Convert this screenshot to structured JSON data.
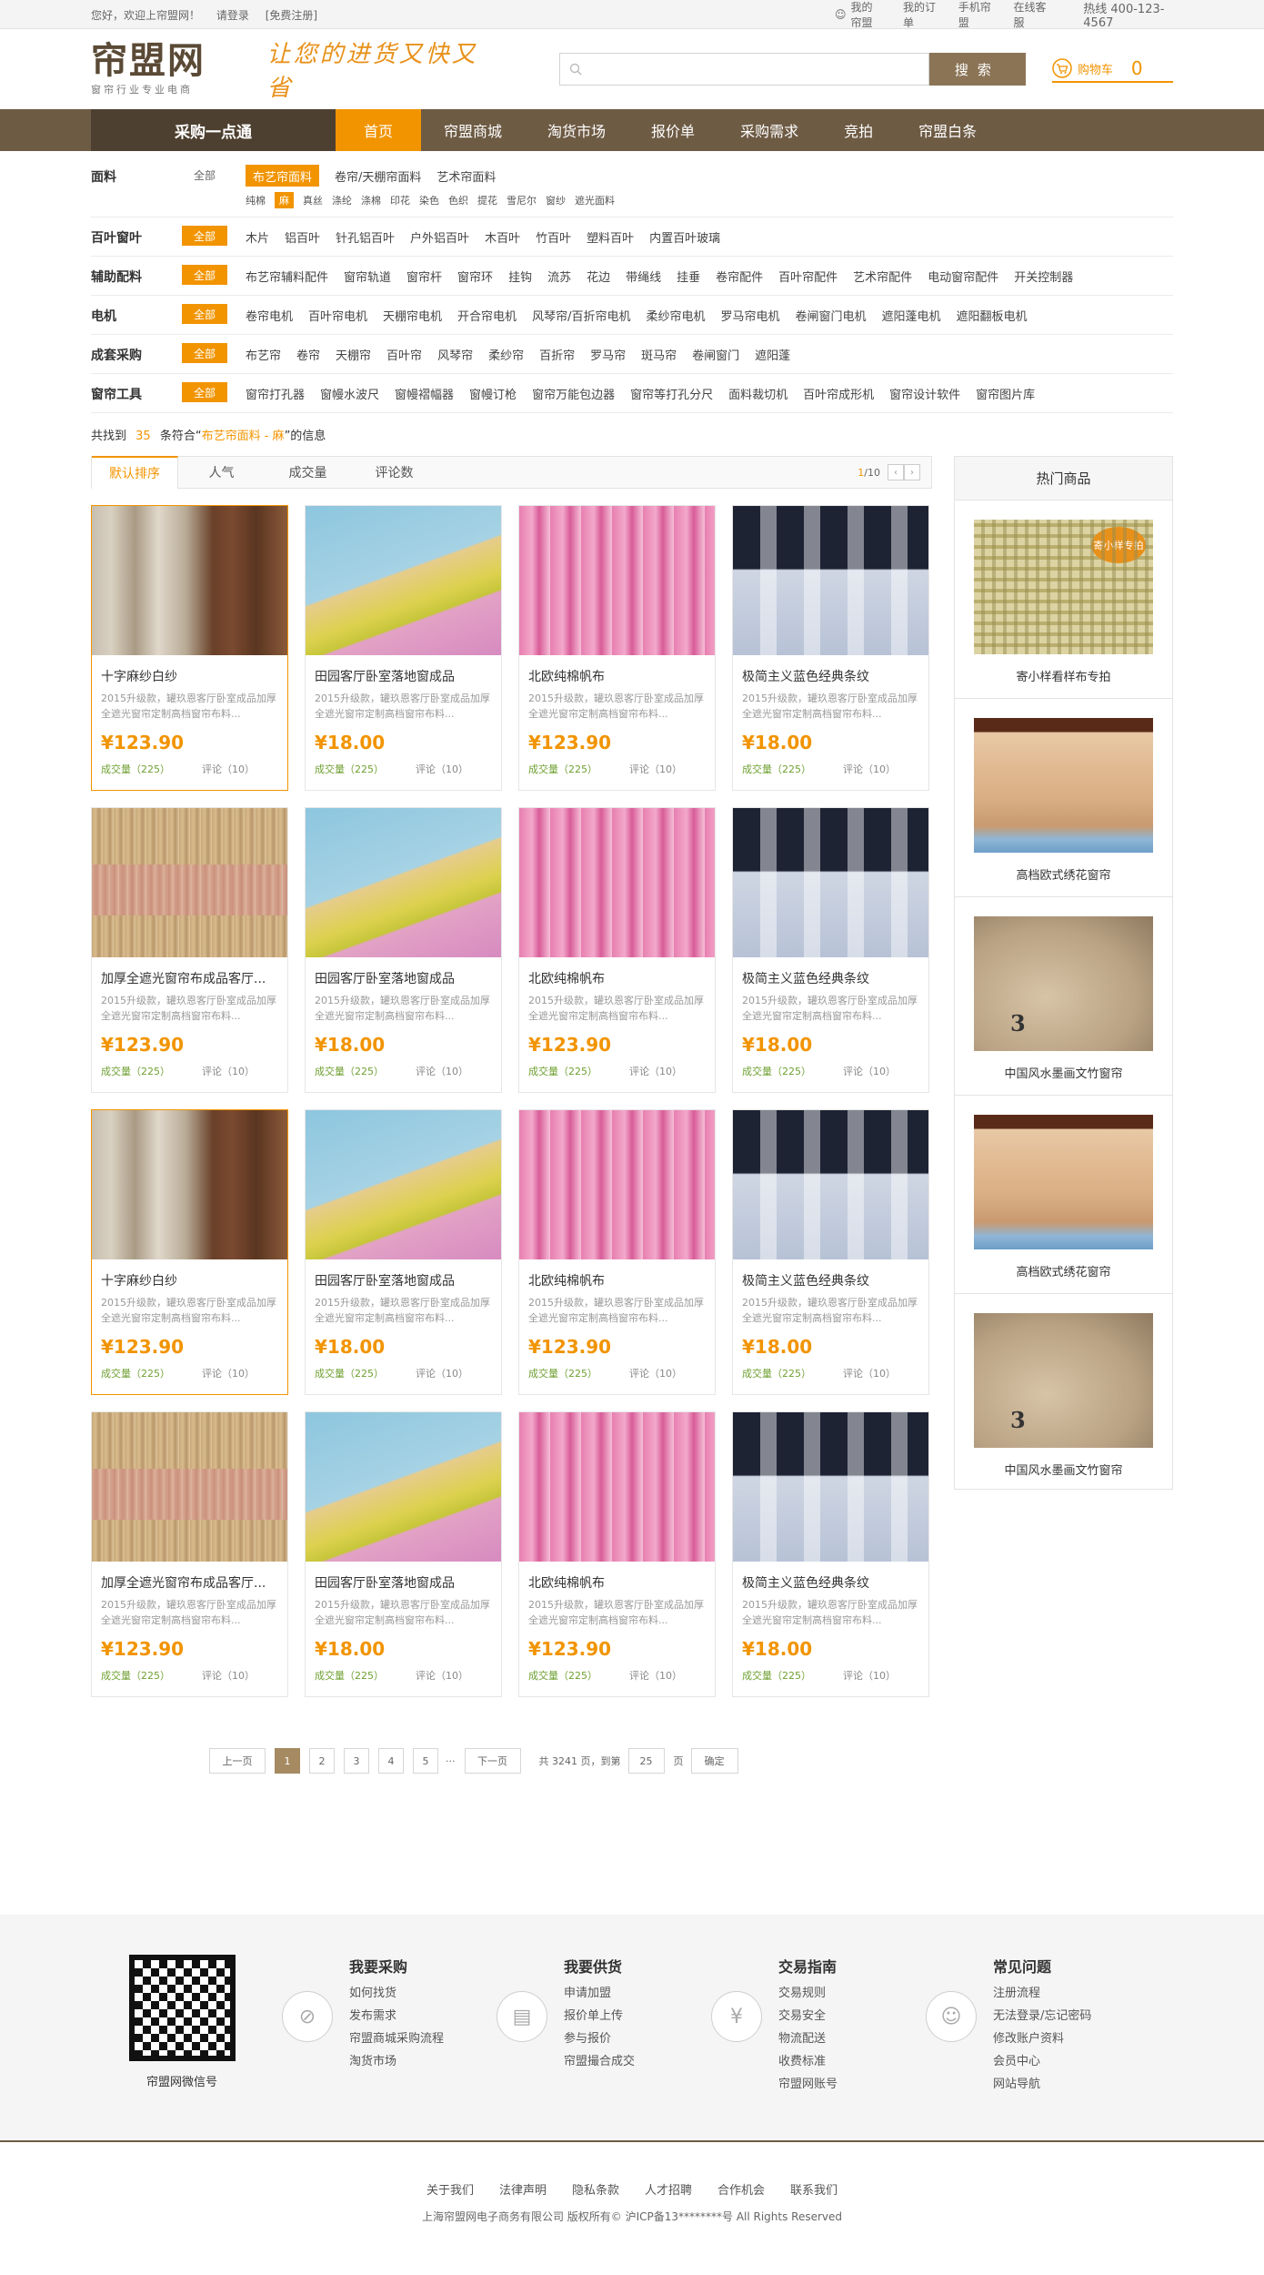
{
  "topbar": {
    "welcome": "您好，欢迎上帘盟网！",
    "login": "请登录",
    "register": "[免费注册]",
    "links": [
      "我的帘盟",
      "我的订单",
      "手机帘盟",
      "在线客服"
    ],
    "hotline": "热线 400-123-4567"
  },
  "header": {
    "logo_title": "帘盟网",
    "logo_sub": "窗帘行业专业电商",
    "slogan": "让您的进货又快又省",
    "search_button": "搜索",
    "cart_label": "购物车",
    "cart_count": "0"
  },
  "nav": {
    "category": "采购一点通",
    "items": [
      "首页",
      "帘盟商城",
      "淘货市场",
      "报价单",
      "采购需求",
      "竞拍",
      "帘盟白条"
    ],
    "active_index": 0
  },
  "filters": [
    {
      "label": "面料",
      "all": "全部",
      "all_on": false,
      "options": [
        "布艺帘面料",
        "卷帘/天棚帘面料",
        "艺术帘面料"
      ],
      "selected": 0,
      "sub": [
        "纯棉",
        "麻",
        "真丝",
        "涤纶",
        "涤棉",
        "印花",
        "染色",
        "色织",
        "提花",
        "雪尼尔",
        "窗纱",
        "遮光面料"
      ],
      "sub_selected": 1
    },
    {
      "label": "百叶窗叶",
      "all": "全部",
      "all_on": true,
      "options": [
        "木片",
        "铝百叶",
        "针孔铝百叶",
        "户外铝百叶",
        "木百叶",
        "竹百叶",
        "塑料百叶",
        "内置百叶玻璃"
      ]
    },
    {
      "label": "辅助配料",
      "all": "全部",
      "all_on": true,
      "options": [
        "布艺帘辅料配件",
        "窗帘轨道",
        "窗帘杆",
        "窗帘环",
        "挂钩",
        "流苏",
        "花边",
        "带绳线",
        "挂垂",
        "卷帘配件",
        "百叶帘配件",
        "艺术帘配件",
        "电动窗帘配件",
        "开关控制器"
      ]
    },
    {
      "label": "电机",
      "all": "全部",
      "all_on": true,
      "options": [
        "卷帘电机",
        "百叶帘电机",
        "天棚帘电机",
        "开合帘电机",
        "风琴帘/百折帘电机",
        "柔纱帘电机",
        "罗马帘电机",
        "卷闸窗门电机",
        "遮阳蓬电机",
        "遮阳翻板电机"
      ]
    },
    {
      "label": "成套采购",
      "all": "全部",
      "all_on": true,
      "options": [
        "布艺帘",
        "卷帘",
        "天棚帘",
        "百叶帘",
        "风琴帘",
        "柔纱帘",
        "百折帘",
        "罗马帘",
        "斑马帘",
        "卷闸窗门",
        "遮阳蓬"
      ]
    },
    {
      "label": "窗帘工具",
      "all": "全部",
      "all_on": true,
      "options": [
        "窗帘打孔器",
        "窗幔水波尺",
        "窗幔褶幅器",
        "窗幔订枪",
        "窗帘万能包边器",
        "窗帘等打孔分尺",
        "面料裁切机",
        "百叶帘成形机",
        "窗帘设计软件",
        "窗帘图片库"
      ]
    }
  ],
  "result": {
    "prefix": "共找到",
    "count": "35",
    "mid": "条符合“",
    "keyword": "布艺帘面料 - 麻",
    "suffix": "”的信息"
  },
  "sort": {
    "tabs": [
      "默认排序",
      "人气",
      "成交量",
      "评论数"
    ],
    "active_index": 0,
    "page_current": "1",
    "page_total": "/10",
    "prev_arrow": "‹",
    "next_arrow": "›"
  },
  "products": [
    {
      "name": "十字麻纱白纱",
      "desc": "2015升级款，罐玖恩客厅卧室成品加厚全遮光窗帘定制高档窗帘布料...",
      "price": "¥123.90",
      "deal": "成交量（225）",
      "reviews": "评论（10）",
      "img": "linen",
      "highlight": true
    },
    {
      "name": "田园客厅卧室落地窗成品",
      "desc": "2015升级款，罐玖恩客厅卧室成品加厚全遮光窗帘定制高档窗帘布料...",
      "price": "¥18.00",
      "deal": "成交量（225）",
      "reviews": "评论（10）",
      "img": "blue",
      "highlight": false
    },
    {
      "name": "北欧纯棉帆布",
      "desc": "2015升级款，罐玖恩客厅卧室成品加厚全遮光窗帘定制高档窗帘布料...",
      "price": "¥123.90",
      "deal": "成交量（225）",
      "reviews": "评论（10）",
      "img": "pink",
      "highlight": false
    },
    {
      "name": "极简主义蓝色经典条纹",
      "desc": "2015升级款，罐玖恩客厅卧室成品加厚全遮光窗帘定制高档窗帘布料...",
      "price": "¥18.00",
      "deal": "成交量（225）",
      "reviews": "评论（10）",
      "img": "navy",
      "highlight": false
    },
    {
      "name": "加厚全遮光窗帘布成品客厅...",
      "desc": "2015升级款，罐玖恩客厅卧室成品加厚全遮光窗帘定制高档窗帘布料...",
      "price": "¥123.90",
      "deal": "成交量（225）",
      "reviews": "评论（10）",
      "img": "stripe",
      "highlight": false
    },
    {
      "name": "田园客厅卧室落地窗成品",
      "desc": "2015升级款，罐玖恩客厅卧室成品加厚全遮光窗帘定制高档窗帘布料...",
      "price": "¥18.00",
      "deal": "成交量（225）",
      "reviews": "评论（10）",
      "img": "blue",
      "highlight": false
    },
    {
      "name": "北欧纯棉帆布",
      "desc": "2015升级款，罐玖恩客厅卧室成品加厚全遮光窗帘定制高档窗帘布料...",
      "price": "¥123.90",
      "deal": "成交量（225）",
      "reviews": "评论（10）",
      "img": "pink",
      "highlight": false
    },
    {
      "name": "极简主义蓝色经典条纹",
      "desc": "2015升级款，罐玖恩客厅卧室成品加厚全遮光窗帘定制高档窗帘布料...",
      "price": "¥18.00",
      "deal": "成交量（225）",
      "reviews": "评论（10）",
      "img": "navy",
      "highlight": false
    },
    {
      "name": "十字麻纱白纱",
      "desc": "2015升级款，罐玖恩客厅卧室成品加厚全遮光窗帘定制高档窗帘布料...",
      "price": "¥123.90",
      "deal": "成交量（225）",
      "reviews": "评论（10）",
      "img": "linen",
      "highlight": true
    },
    {
      "name": "田园客厅卧室落地窗成品",
      "desc": "2015升级款，罐玖恩客厅卧室成品加厚全遮光窗帘定制高档窗帘布料...",
      "price": "¥18.00",
      "deal": "成交量（225）",
      "reviews": "评论（10）",
      "img": "blue",
      "highlight": false
    },
    {
      "name": "北欧纯棉帆布",
      "desc": "2015升级款，罐玖恩客厅卧室成品加厚全遮光窗帘定制高档窗帘布料...",
      "price": "¥123.90",
      "deal": "成交量（225）",
      "reviews": "评论（10）",
      "img": "pink",
      "highlight": false
    },
    {
      "name": "极简主义蓝色经典条纹",
      "desc": "2015升级款，罐玖恩客厅卧室成品加厚全遮光窗帘定制高档窗帘布料...",
      "price": "¥18.00",
      "deal": "成交量（225）",
      "reviews": "评论（10）",
      "img": "navy",
      "highlight": false
    },
    {
      "name": "加厚全遮光窗帘布成品客厅...",
      "desc": "2015升级款，罐玖恩客厅卧室成品加厚全遮光窗帘定制高档窗帘布料...",
      "price": "¥123.90",
      "deal": "成交量（225）",
      "reviews": "评论（10）",
      "img": "stripe",
      "highlight": false
    },
    {
      "name": "田园客厅卧室落地窗成品",
      "desc": "2015升级款，罐玖恩客厅卧室成品加厚全遮光窗帘定制高档窗帘布料...",
      "price": "¥18.00",
      "deal": "成交量（225）",
      "reviews": "评论（10）",
      "img": "blue",
      "highlight": false
    },
    {
      "name": "北欧纯棉帆布",
      "desc": "2015升级款，罐玖恩客厅卧室成品加厚全遮光窗帘定制高档窗帘布料...",
      "price": "¥123.90",
      "deal": "成交量（225）",
      "reviews": "评论（10）",
      "img": "pink",
      "highlight": false
    },
    {
      "name": "极简主义蓝色经典条纹",
      "desc": "2015升级款，罐玖恩客厅卧室成品加厚全遮光窗帘定制高档窗帘布料...",
      "price": "¥18.00",
      "deal": "成交量（225）",
      "reviews": "评论（10）",
      "img": "navy",
      "highlight": false
    }
  ],
  "side": {
    "title": "热门商品",
    "items": [
      {
        "name": "寄小样看样布专拍",
        "img": "plaid",
        "tag": "寄小样专拍"
      },
      {
        "name": "高档欧式绣花窗帘",
        "img": "roman"
      },
      {
        "name": "中国风水墨画文竹窗帘",
        "img": "roll",
        "tag": "3"
      },
      {
        "name": "高档欧式绣花窗帘",
        "img": "roman"
      },
      {
        "name": "中国风水墨画文竹窗帘",
        "img": "roll",
        "tag": "3"
      }
    ]
  },
  "pager": {
    "prev": "上一页",
    "pages": [
      "1",
      "2",
      "3",
      "4",
      "5"
    ],
    "current": "1",
    "ellipsis": "···",
    "next": "下一页",
    "total_text": "共 3241 页，到第",
    "goto_value": "25",
    "page_unit": "页",
    "confirm": "确定"
  },
  "footer": {
    "qr_caption": "帘盟网微信号",
    "columns": [
      {
        "title": "我要采购",
        "icon": "compass-icon",
        "links": [
          "如何找货",
          "发布需求",
          "帘盟商城采购流程",
          "淘货市场"
        ]
      },
      {
        "title": "我要供货",
        "icon": "printer-icon",
        "links": [
          "申请加盟",
          "报价单上传",
          "参与报价",
          "帘盟撮合成交"
        ]
      },
      {
        "title": "交易指南",
        "icon": "yen-icon",
        "links": [
          "交易规则",
          "交易安全",
          "物流配送",
          "收费标准",
          "帘盟网账号"
        ]
      },
      {
        "title": "常见问题",
        "icon": "user-icon",
        "links": [
          "注册流程",
          "无法登录/忘记密码",
          "修改账户资料",
          "会员中心",
          "网站导航"
        ]
      }
    ],
    "bottom_links": [
      "关于我们",
      "法律声明",
      "隐私条款",
      "人才招聘",
      "合作机会",
      "联系我们"
    ],
    "copyright": "上海帘盟网电子商务有限公司 版权所有© 沪ICP备13********号 All Rights Reserved"
  },
  "colors": {
    "accent": "#f29400",
    "brand_brown": "#6e5b44",
    "dark_brown": "#4e4030",
    "deal_green": "#6fa032"
  }
}
